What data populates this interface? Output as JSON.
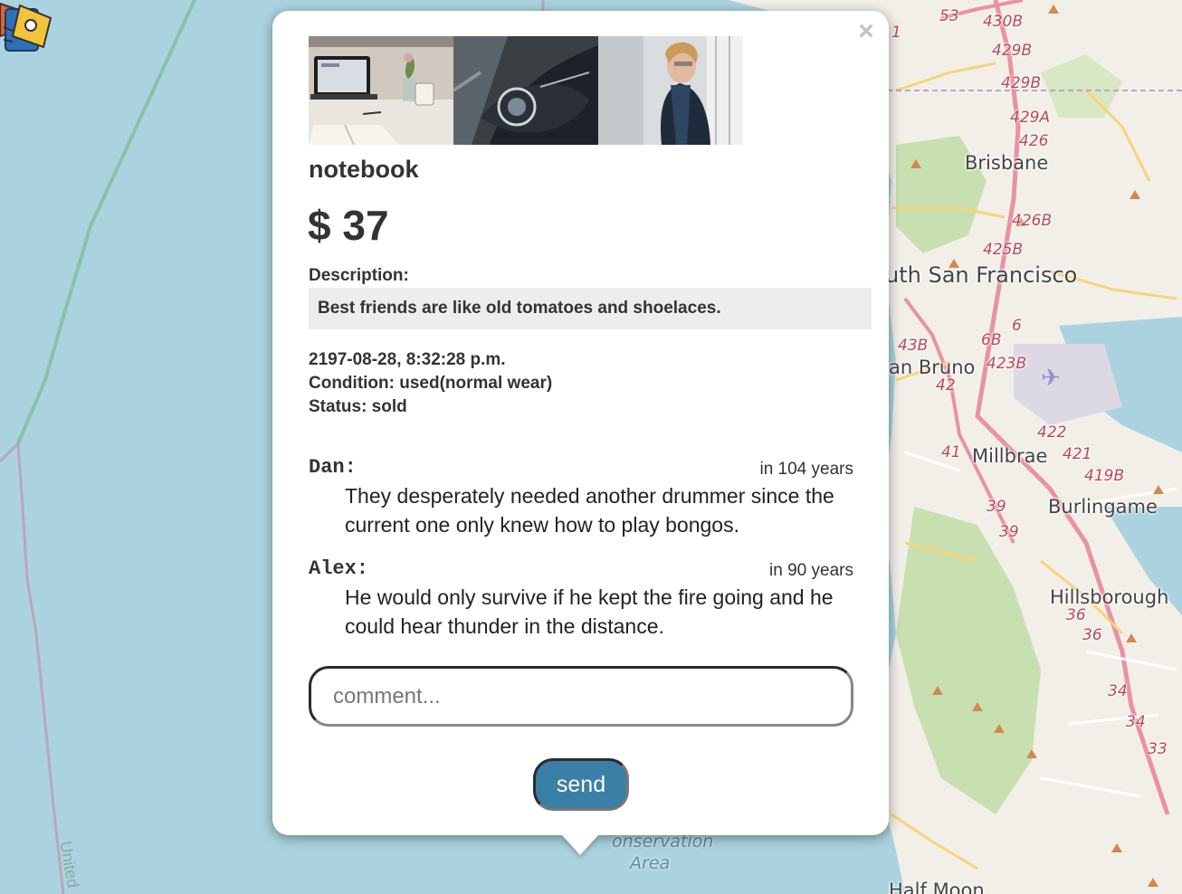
{
  "map": {
    "cities": [
      "Brisbane",
      "uth San Francisco",
      "an Bruno",
      "Millbrae",
      "Burlingame",
      "Hillsborough",
      "Half Moon"
    ],
    "road_numbers": [
      "53",
      "430B",
      "429B",
      "429B",
      "429A",
      "426",
      "426B",
      "425B",
      "6",
      "6B",
      "43B",
      "423B",
      "42",
      "422",
      "41",
      "421",
      "419B",
      "39",
      "39",
      "36",
      "36",
      "34",
      "34",
      "33",
      "1"
    ],
    "conservation_label_1": "onservation",
    "conservation_label_2": "Area",
    "united_label": "United"
  },
  "popup": {
    "close_label": "×",
    "photos": [
      "laptop-desk-photo",
      "car-headlight-photo",
      "person-scarf-photo"
    ],
    "title": "notebook",
    "price": "$ 37",
    "description_label": "Description:",
    "description": "Best friends are like old tomatoes and shoelaces.",
    "timestamp": "2197-08-28, 8:32:28 p.m.",
    "condition": "Condition: used(normal wear)",
    "status": "Status: sold",
    "comments": [
      {
        "author": "Dan:",
        "time": "in 104 years",
        "text": "They desperately needed another drummer since the current one only knew how to play bongos."
      },
      {
        "author": "Alex:",
        "time": "in 90 years",
        "text": "He would only survive if he kept the fire going and he could hear thunder in the distance."
      }
    ],
    "comment_placeholder": "comment...",
    "send_label": "send"
  },
  "colors": {
    "water": "#abd3df",
    "land": "#f2efe9",
    "park": "#c8e0b0",
    "road_major": "#e892a2",
    "road_minor": "#f9d37a",
    "send_button": "#3a7fa6"
  }
}
